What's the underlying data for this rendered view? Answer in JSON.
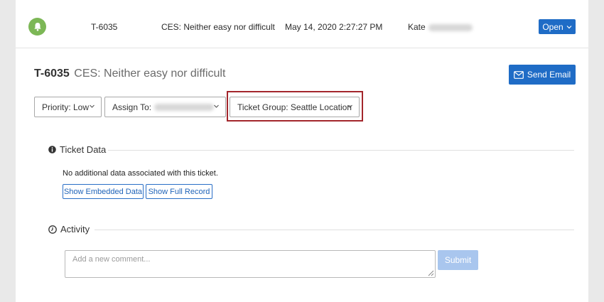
{
  "header": {
    "ticket_id": "T-6035",
    "subject": "CES: Neither easy nor difficult",
    "timestamp": "May 14, 2020 2:27:27 PM",
    "owner_first": "Kate",
    "status_button": "Open",
    "status_icon_color": "#7cb756",
    "icon": "bell-icon"
  },
  "title": {
    "ticket_id": "T-6035",
    "subject": "CES: Neither easy nor difficult"
  },
  "actions": {
    "send_email": "Send Email",
    "send_email_icon": "envelope-icon"
  },
  "dropdowns": {
    "priority": "Priority: Low",
    "assign_to": "Assign To:",
    "ticket_group": "Ticket Group: Seattle Location"
  },
  "ticket_data": {
    "heading": "Ticket Data",
    "message": "No additional data associated with this ticket.",
    "show_embedded": "Show Embedded Data",
    "show_full_record": "Show Full Record"
  },
  "activity": {
    "heading": "Activity",
    "comment_placeholder": "Add a new comment...",
    "submit": "Submit"
  },
  "colors": {
    "primary": "#1f6cc6",
    "highlight_border": "#a3262c",
    "submit_disabled": "#a9c6ee"
  }
}
